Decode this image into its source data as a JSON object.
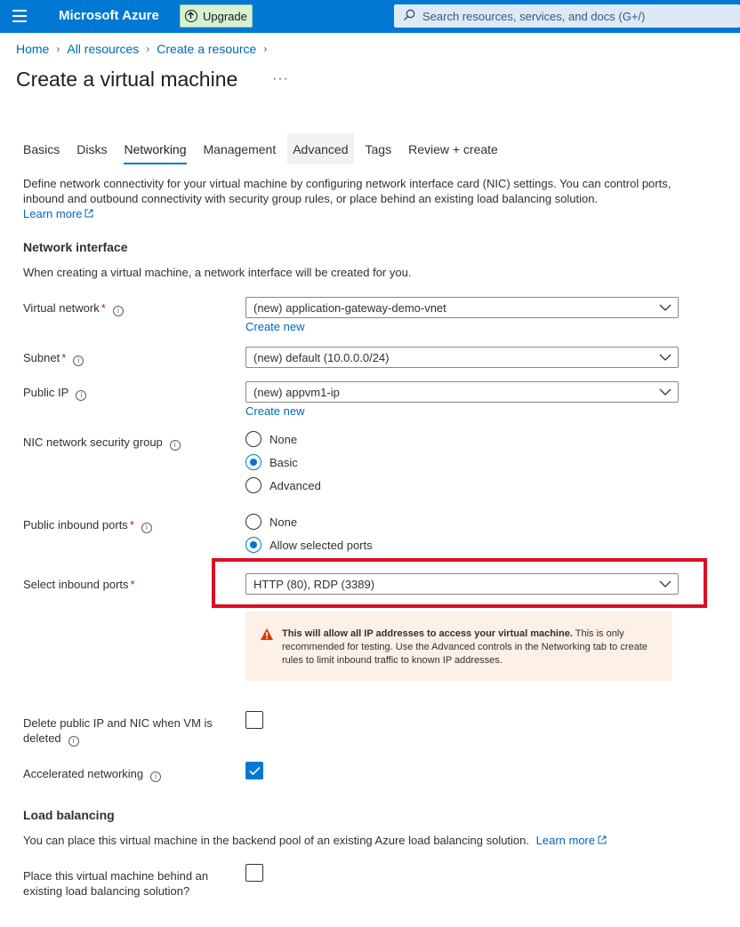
{
  "app": {
    "brand": "Microsoft Azure",
    "upgrade_label": "Upgrade",
    "search_placeholder": "Search resources, services, and docs (G+/)"
  },
  "breadcrumb": [
    "Home",
    "All resources",
    "Create a resource"
  ],
  "page_title": "Create a virtual machine",
  "more_label": "···",
  "tabs": [
    "Basics",
    "Disks",
    "Networking",
    "Management",
    "Advanced",
    "Tags",
    "Review + create"
  ],
  "active_tab": "Networking",
  "description": "Define network connectivity for your virtual machine by configuring network interface card (NIC) settings. You can control ports, inbound and outbound connectivity with security group rules, or place behind an existing load balancing solution.",
  "learn_more": "Learn more",
  "network_interface": {
    "title": "Network interface",
    "text": "When creating a virtual machine, a network interface will be created for you.",
    "virtual_network": {
      "label": "Virtual network",
      "value": "(new) application-gateway-demo-vnet",
      "create_new": "Create new"
    },
    "subnet": {
      "label": "Subnet",
      "value": "(new) default (10.0.0.0/24)"
    },
    "public_ip": {
      "label": "Public IP",
      "value": "(new) appvm1-ip",
      "create_new": "Create new"
    },
    "nic_nsg": {
      "label": "NIC network security group",
      "options": [
        "None",
        "Basic",
        "Advanced"
      ],
      "selected": "Basic"
    },
    "public_inbound": {
      "label": "Public inbound ports",
      "options": [
        "None",
        "Allow selected ports"
      ],
      "selected": "Allow selected ports"
    },
    "select_inbound": {
      "label": "Select inbound ports",
      "value": "HTTP (80), RDP (3389)"
    },
    "warning": {
      "bold": "This will allow all IP addresses to access your virtual machine.",
      "text": "This is only recommended for testing.  Use the Advanced controls in the Networking tab to create rules to limit inbound traffic to known IP addresses."
    },
    "delete_ip_nic": {
      "label_line1": "Delete public IP and NIC when VM is",
      "label_line2": "deleted",
      "checked": false
    },
    "accelerated": {
      "label": "Accelerated networking",
      "checked": true
    }
  },
  "load_balancing": {
    "title": "Load balancing",
    "text": "You can place this virtual machine in the backend pool of an existing Azure load balancing solution.",
    "learn_more": "Learn more",
    "place_behind": {
      "label_line1": "Place this virtual machine behind an",
      "label_line2": "existing load balancing solution?",
      "checked": false
    }
  },
  "colors": {
    "accent": "#0078d4",
    "link": "#0067b8",
    "required": "#a4262c",
    "highlight": "#e00d22",
    "warning_bg": "#fdf0e6",
    "warning_icon": "#d83b01"
  }
}
